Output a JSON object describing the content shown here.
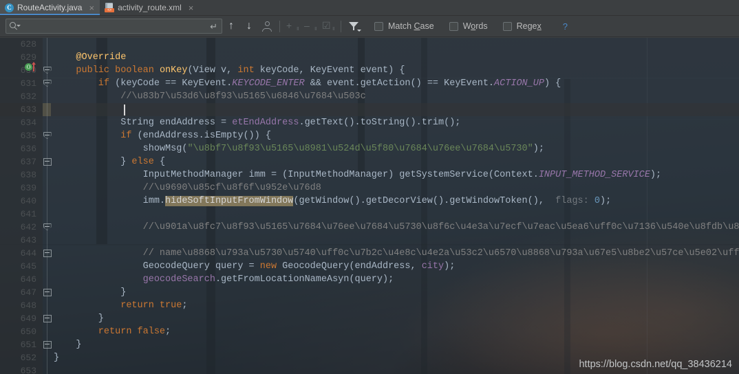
{
  "tabs": [
    {
      "label": "RouteActivity.java",
      "icon": "java-class-icon",
      "active": true,
      "close": "×"
    },
    {
      "label": "activity_route.xml",
      "icon": "xml-layout-icon",
      "active": false,
      "close": "×"
    }
  ],
  "find_toolbar": {
    "search_value": "",
    "search_placeholder": "",
    "icons": {
      "search": "search-icon",
      "enter": "↵",
      "prev": "↑",
      "next": "↓",
      "select_all_occurrences": "select-all-occurrences-icon",
      "add_selection": "add-selection-icon",
      "remove_selection": "remove-selection-icon",
      "select_all_icon": "select-all-icon",
      "filter": "filter-icon"
    },
    "options": [
      {
        "label": "Match Case",
        "mnemonic": "C",
        "checked": false
      },
      {
        "label": "Words",
        "mnemonic": "o",
        "checked": false
      },
      {
        "label": "Regex",
        "mnemonic": "x",
        "checked": false
      }
    ],
    "help": "?"
  },
  "editor": {
    "current_line": 633,
    "first_line": 628,
    "last_line": 653,
    "line_numbers": [
      628,
      629,
      630,
      631,
      632,
      633,
      634,
      635,
      636,
      637,
      638,
      639,
      640,
      641,
      642,
      643,
      644,
      645,
      646,
      647,
      648,
      649,
      650,
      651,
      652,
      653
    ],
    "lines": [
      {
        "n": 628,
        "indent": 0,
        "text": ""
      },
      {
        "n": 629,
        "indent": 0,
        "text": "@Override"
      },
      {
        "n": 630,
        "indent": 0,
        "text": "public boolean onKey(View v, int keyCode, KeyEvent event) {"
      },
      {
        "n": 631,
        "indent": 0,
        "text": "if (keyCode == KeyEvent.KEYCODE_ENTER && event.getAction() == KeyEvent.ACTION_UP) {"
      },
      {
        "n": 632,
        "indent": 0,
        "text": "//获取输入框的值"
      },
      {
        "n": 633,
        "indent": 0,
        "text": ""
      },
      {
        "n": 634,
        "indent": 0,
        "text": "String endAddress = etEndAddress.getText().toString().trim();"
      },
      {
        "n": 635,
        "indent": 0,
        "text": "if (endAddress.isEmpty()) {"
      },
      {
        "n": 636,
        "indent": 0,
        "text": "showMsg(\"请输入要前往的目的地\");"
      },
      {
        "n": 637,
        "indent": 0,
        "text": "} else {"
      },
      {
        "n": 638,
        "indent": 0,
        "text": "InputMethodManager imm = (InputMethodManager) getSystemService(Context.INPUT_METHOD_SERVICE);"
      },
      {
        "n": 639,
        "indent": 0,
        "text": "//隐藏软键盘"
      },
      {
        "n": 640,
        "indent": 0,
        "text": "imm.hideSoftInputFromWindow(getWindow().getDecorView().getWindowToken(),  flags: 0);"
      },
      {
        "n": 641,
        "indent": 0,
        "text": ""
      },
      {
        "n": 642,
        "indent": 0,
        "text": "//通过输入的目的地转为经纬度，然后进行地图上添加标点，最后计算出行路线规划"
      },
      {
        "n": 643,
        "indent": 0,
        "text": ""
      },
      {
        "n": 644,
        "indent": 0,
        "text": "// name表示地址，第二个参数表示查询城市，中文或者中文全拼， citycode、adcode"
      },
      {
        "n": 645,
        "indent": 0,
        "text": "GeocodeQuery query = new GeocodeQuery(endAddress, city);"
      },
      {
        "n": 646,
        "indent": 0,
        "text": "geocodeSearch.getFromLocationNameAsyn(query);"
      },
      {
        "n": 647,
        "indent": 0,
        "text": "}"
      },
      {
        "n": 648,
        "indent": 0,
        "text": "return true;"
      },
      {
        "n": 649,
        "indent": 0,
        "text": "}"
      },
      {
        "n": 650,
        "indent": 0,
        "text": "return false;"
      },
      {
        "n": 651,
        "indent": 0,
        "text": "}"
      },
      {
        "n": 652,
        "indent": 0,
        "text": "}"
      },
      {
        "n": 653,
        "indent": 0,
        "text": ""
      }
    ],
    "search_match_text": "hideSoftInputFromWindow",
    "parameter_hint": "flags:",
    "typos": [
      "citycode",
      "adcode"
    ],
    "gutter_markers": [
      {
        "line": 630,
        "type": "overriding-method-marker"
      }
    ],
    "fold_lines": [
      630,
      631,
      635,
      637,
      642,
      644,
      647,
      649,
      651
    ]
  },
  "watermark": "https://blog.csdn.net/qq_38436214",
  "colors": {
    "accent": "#4a88c7",
    "keyword": "#cc7832",
    "comment": "#808080",
    "string": "#6a8759",
    "field": "#9876aa",
    "method": "#ffc66d",
    "number": "#6897bb",
    "plain": "#a9b7c6",
    "match_highlight": "#82775a",
    "typo_underline": "#4e9a3f",
    "tab_active_bg": "#4e5254",
    "toolbar_bg": "#3c3f41"
  }
}
